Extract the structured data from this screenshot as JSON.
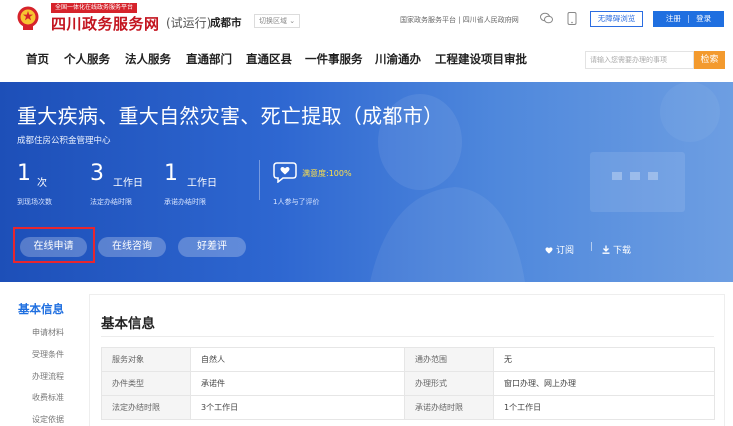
{
  "header": {
    "brand_tag": "全国一体化在线政务服务平台",
    "site_name": "四川政务服务网",
    "site_status": "(试运行)",
    "city": "成都市",
    "switch_region": "切换区域 ⌄",
    "top_links": "国家政务服务平台 | 四川省人民政府网",
    "accessibility": "无障碍浏览",
    "register": "注册",
    "login": "登录",
    "auth_sep": "|"
  },
  "nav": {
    "items": [
      "首页",
      "个人服务",
      "法人服务",
      "直通部门",
      "直通区县",
      "一件事服务",
      "川渝通办",
      "工程建设项目审批"
    ],
    "search_placeholder": "请输入您需要办理的事项",
    "search_label": "检索"
  },
  "hero": {
    "title": "重大疾病、重大自然灾害、死亡提取（成都市）",
    "org": "成都住房公积金管理中心",
    "stats": [
      {
        "num": "1",
        "unit": "次",
        "label": "到现场次数"
      },
      {
        "num": "3",
        "unit": "工作日",
        "label": "法定办结时限"
      },
      {
        "num": "1",
        "unit": "工作日",
        "label": "承诺办结时限"
      }
    ],
    "satisfaction": "满意度:100%",
    "rating_count": "1人参与了评价",
    "buttons": [
      "在线申请",
      "在线咨询",
      "好差评"
    ],
    "subscribe": "订阅",
    "separator": "|",
    "download": "下载"
  },
  "sidebar": {
    "heading": "基本信息",
    "items": [
      "申请材料",
      "受理条件",
      "办理流程",
      "收费标准",
      "设定依据"
    ]
  },
  "content": {
    "title": "基本信息",
    "rows": [
      [
        "服务对象",
        "自然人",
        "通办范围",
        "无"
      ],
      [
        "办件类型",
        "承诺件",
        "办理形式",
        "窗口办理、网上办理"
      ],
      [
        "法定办结时限",
        "3个工作日",
        "承诺办结时限",
        "1个工作日"
      ]
    ]
  },
  "colors": {
    "brand_red": "#c3141f",
    "accent_blue": "#1f6fe0",
    "search_orange": "#f39a2e",
    "hero_blue": "#2e67d1",
    "highlight_red": "#e8262e",
    "satisfaction_yellow": "#ffe14a"
  },
  "icons": [
    "national-emblem-icon",
    "wechat-icon",
    "mobile-icon",
    "satisfaction-heart-icon",
    "heart-icon",
    "download-icon"
  ]
}
